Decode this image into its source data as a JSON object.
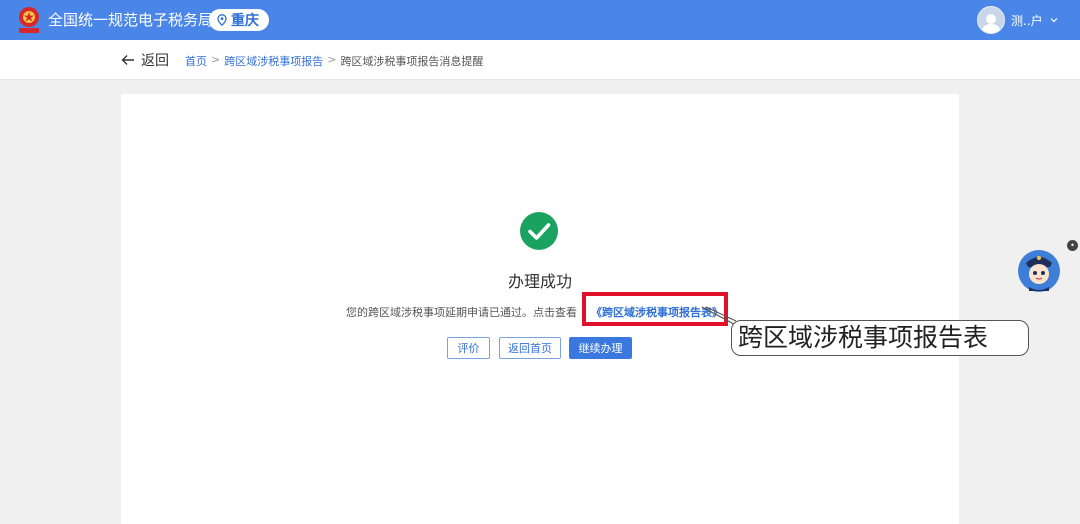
{
  "header": {
    "site_title": "全国统一规范电子税务局",
    "region": "重庆",
    "user_name": "测..户"
  },
  "nav": {
    "back_label": "返回",
    "breadcrumb": [
      "首页",
      "跨区域涉税事项报告",
      "跨区域涉税事项报告消息提醒"
    ]
  },
  "result": {
    "title": "办理成功",
    "description": "您的跨区域涉税事项延期申请已通过。点击查看",
    "report_link": "《跨区域涉税事项报告表》"
  },
  "buttons": {
    "rate": "评价",
    "home": "返回首页",
    "continue": "继续办理"
  },
  "callout": {
    "text": "跨区域涉税事项报告表"
  },
  "colors": {
    "header_bg": "#4a86e8",
    "success_green": "#1aa260",
    "highlight_red": "#e0112b",
    "link_blue": "#2f6fd6"
  }
}
